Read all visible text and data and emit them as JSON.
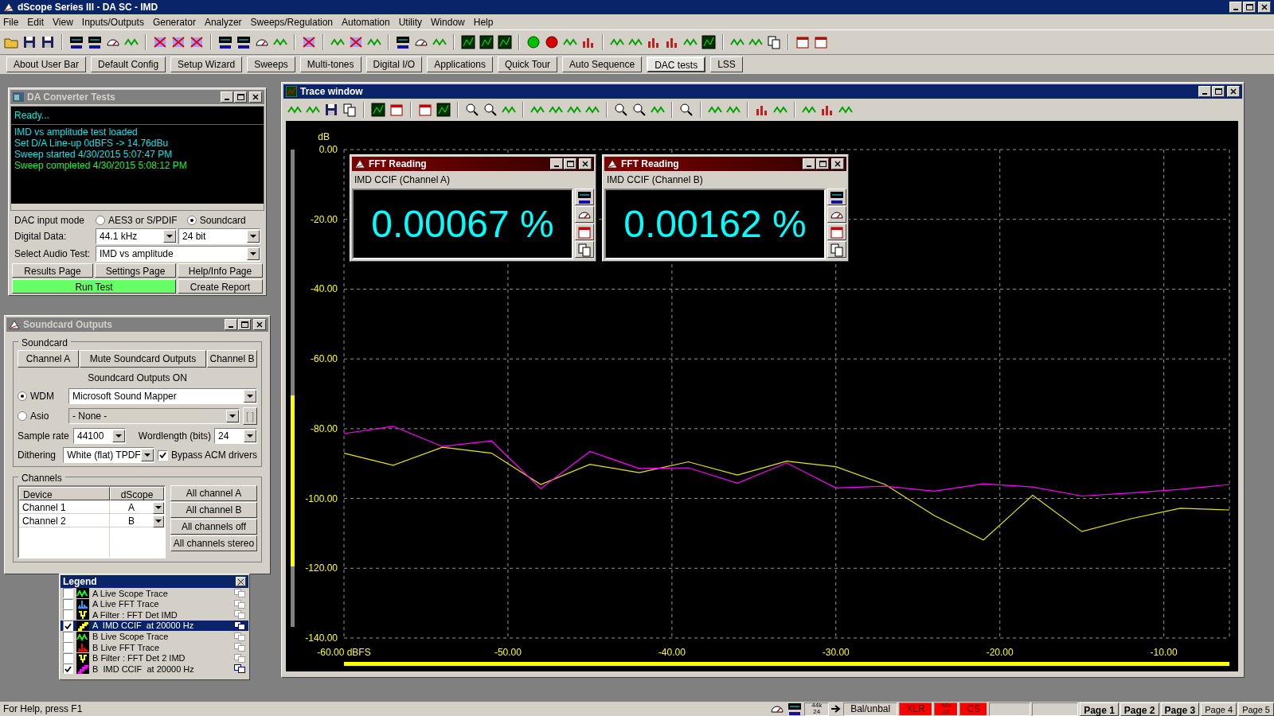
{
  "window": {
    "title": "dScope Series III - DA SC - IMD"
  },
  "menu": [
    "File",
    "Edit",
    "View",
    "Inputs/Outputs",
    "Generator",
    "Analyzer",
    "Sweeps/Regulation",
    "Automation",
    "Utility",
    "Window",
    "Help"
  ],
  "user_bar": [
    {
      "label": "About User Bar",
      "selected": false
    },
    {
      "label": "Default Config",
      "selected": false
    },
    {
      "label": "Setup Wizard",
      "selected": false
    },
    {
      "label": "Sweeps",
      "selected": false
    },
    {
      "label": "Multi-tones",
      "selected": false
    },
    {
      "label": "Digital I/O",
      "selected": false
    },
    {
      "label": "Applications",
      "selected": false
    },
    {
      "label": "Quick Tour",
      "selected": false
    },
    {
      "label": "Auto Sequence",
      "selected": false
    },
    {
      "label": "DAC tests",
      "selected": true
    },
    {
      "label": "LSS",
      "selected": false
    }
  ],
  "da_converter": {
    "title": "DA Converter Tests",
    "status": "Ready...",
    "log": [
      {
        "text": "IMD vs amplitude test loaded",
        "kind": "info"
      },
      {
        "text": "Set D/A Line-up 0dBFS -> 14.76dBu",
        "kind": "info"
      },
      {
        "text": "Sweep started 4/30/2015 5:07:47 PM",
        "kind": "info"
      },
      {
        "text": "Sweep completed 4/30/2015 5:08:12 PM",
        "kind": "done"
      }
    ],
    "input_mode_label": "DAC input mode",
    "input_modes": [
      {
        "label": "AES3 or S/PDIF",
        "selected": false
      },
      {
        "label": "Soundcard",
        "selected": true
      }
    ],
    "digital_data_label": "Digital Data:",
    "sample_rate": "44.1 kHz",
    "bit_depth": "24 bit",
    "audio_test_label": "Select Audio Test:",
    "audio_test": "IMD vs amplitude",
    "buttons": [
      {
        "label": "Results Page",
        "highlighted": false
      },
      {
        "label": "Settings Page",
        "highlighted": false
      },
      {
        "label": "Help/Info Page",
        "highlighted": false
      },
      {
        "label": "Run Test",
        "highlighted": true
      },
      {
        "label": "Create Report",
        "highlighted": false
      }
    ]
  },
  "soundcard_outputs": {
    "title": "Soundcard Outputs",
    "group_label": "Soundcard",
    "channel_buttons": [
      "Channel A",
      "Mute Soundcard Outputs",
      "Channel B"
    ],
    "status": "Soundcard Outputs ON",
    "drivers": [
      {
        "label": "WDM",
        "selected": true,
        "device": "Microsoft Sound Mapper"
      },
      {
        "label": "Asio",
        "selected": false,
        "device": "- None -",
        "button": "[ ]"
      }
    ],
    "sample_rate_label": "Sample rate",
    "sample_rate": "44100",
    "wordlength_label": "Wordlength (bits)",
    "wordlength": "24",
    "dithering_label": "Dithering",
    "dithering": "White (flat) TPDF",
    "bypass": {
      "label": "Bypass ACM drivers",
      "checked": true
    },
    "channels_label": "Channels",
    "table": {
      "columns": [
        "Device",
        "dScope"
      ],
      "rows": [
        [
          "Channel 1",
          "A"
        ],
        [
          "Channel 2",
          "B"
        ]
      ]
    },
    "channel_actions": [
      "All channel A",
      "All channel B",
      "All channels off",
      "All channels stereo"
    ]
  },
  "legend": {
    "title": "Legend",
    "items": [
      {
        "channel": "A",
        "label": "Live Scope Trace",
        "kind": "scope",
        "color": "#00ff00",
        "checked": false,
        "selected": false
      },
      {
        "channel": "A",
        "label": "Live FFT Trace",
        "kind": "fft",
        "color": "#3399ff",
        "checked": false,
        "selected": false
      },
      {
        "channel": "A",
        "label": "Filter : FFT Det IMD",
        "kind": "filter",
        "color": "#ffff00",
        "checked": false,
        "selected": false
      },
      {
        "channel": "A",
        "label": " IMD CCIF  at 20000 Hz",
        "kind": "sweep",
        "color": "#ffff00",
        "checked": true,
        "selected": true
      },
      {
        "channel": "B",
        "label": "Live Scope Trace",
        "kind": "scope",
        "color": "#00ff00",
        "checked": false,
        "selected": false
      },
      {
        "channel": "B",
        "label": "Live FFT Trace",
        "kind": "fft",
        "color": "#ff0000",
        "checked": false,
        "selected": false
      },
      {
        "channel": "B",
        "label": "Filter : FFT Det 2 IMD",
        "kind": "filter",
        "color": "#ffff00",
        "checked": false,
        "selected": false
      },
      {
        "channel": "B",
        "label": " IMD CCIF  at 20000 Hz",
        "kind": "sweep",
        "color": "#ff00ff",
        "checked": true,
        "selected": false
      }
    ]
  },
  "trace_window": {
    "title": "Trace window",
    "readings": [
      {
        "title": "FFT Reading",
        "label": "IMD CCIF (Channel A)",
        "value": "0.00067 %"
      },
      {
        "title": "FFT Reading",
        "label": "IMD CCIF (Channel B)",
        "value": "0.00162 %"
      }
    ],
    "chart_data": {
      "type": "line",
      "grid": true,
      "ylabel": "dB",
      "xlim": [
        -60,
        -6
      ],
      "ylim": [
        -140,
        0
      ],
      "xticks": [
        {
          "value": -60,
          "label": "-60.00 dBFS"
        },
        {
          "value": -50,
          "label": "-50.00"
        },
        {
          "value": -40,
          "label": "-40.00"
        },
        {
          "value": -30,
          "label": "-30.00"
        },
        {
          "value": -20,
          "label": "-20.00"
        },
        {
          "value": -10,
          "label": "-10.00"
        }
      ],
      "yticks": [
        {
          "value": 0,
          "label": "0.00"
        },
        {
          "value": -20,
          "label": "-20.00"
        },
        {
          "value": -40,
          "label": "-40.00"
        },
        {
          "value": -60,
          "label": "-60.00"
        },
        {
          "value": -80,
          "label": "-80.00"
        },
        {
          "value": -100,
          "label": "-100.00"
        },
        {
          "value": -120,
          "label": "-120.00"
        },
        {
          "value": -140,
          "label": "-140.00"
        }
      ],
      "x": [
        -60,
        -57,
        -54,
        -51,
        -48,
        -45,
        -42,
        -39,
        -36,
        -33,
        -30,
        -27,
        -24,
        -21,
        -18,
        -15,
        -12,
        -9,
        -6
      ],
      "series": [
        {
          "color": "#e8e800",
          "values": [
            -87,
            -90.5,
            -85.3,
            -87,
            -96,
            -90.2,
            -92.6,
            -89.5,
            -93.3,
            -89.3,
            -90.9,
            -96,
            -104.9,
            -111.9,
            -99.1,
            -109.5,
            -105.8,
            -102.8,
            -103.3
          ]
        },
        {
          "color": "#ff00ff",
          "values": [
            -81.4,
            -79.3,
            -85.1,
            -83.5,
            -97.2,
            -86.5,
            -91.4,
            -91.2,
            -95.6,
            -89.8,
            -97,
            -96.5,
            -97.9,
            -95.8,
            -96.7,
            -99.3,
            -98.4,
            -97.4,
            -96
          ]
        }
      ]
    }
  },
  "status_bar": {
    "help": "For Help, press F1",
    "indicators": [
      {
        "lines": [
          "44k",
          "24"
        ],
        "alert": false
      },
      {
        "lines": [
          "Bal/unbal"
        ],
        "alert": false
      },
      {
        "lines": [
          "XLR"
        ],
        "alert": true
      },
      {
        "lines": [
          "48k",
          "16"
        ],
        "alert": true
      },
      {
        "lines": [
          "CS"
        ],
        "alert": true
      }
    ],
    "pages": [
      {
        "label": "Page 1",
        "used": true
      },
      {
        "label": "Page 2",
        "used": true
      },
      {
        "label": "Page 3",
        "used": true
      },
      {
        "label": "Page 4",
        "used": false
      },
      {
        "label": "Page 5",
        "used": false
      }
    ]
  }
}
